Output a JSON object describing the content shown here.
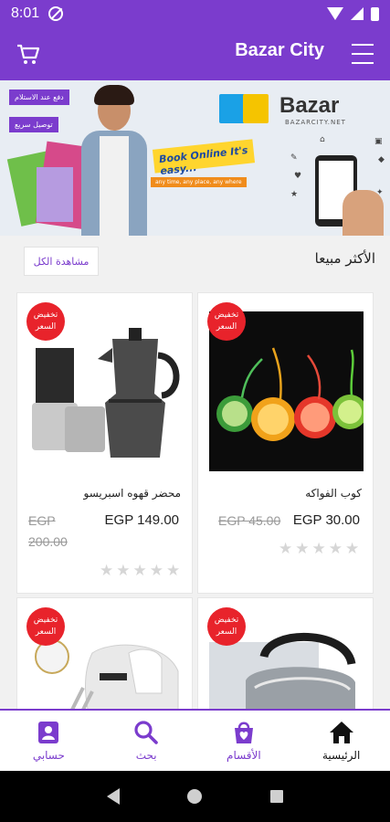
{
  "status_bar": {
    "time": "8:01"
  },
  "app_bar": {
    "title": "Bazar City",
    "cart_icon": "cart-icon",
    "menu_icon": "hamburger-menu-icon"
  },
  "banner": {
    "tag_top": "دفع عند الاستلام",
    "tag_second": "توصيل سريع",
    "book_online": "Book Online It's easy...",
    "slogan": "any time, any place, any where",
    "logo_text": "Bazar",
    "logo_sub": "BAZARCITY.NET"
  },
  "section": {
    "title": "الأكثر مبيعا",
    "see_all": "مشاهدة الكل"
  },
  "products": [
    {
      "badge": "تخفيض السعر",
      "name": "كوب الفواكه",
      "price": "EGP 30.00",
      "old_price": "EGP 45.00",
      "rating": 0
    },
    {
      "badge": "تخفيض السعر",
      "name": "محضر قهوه اسبريسو",
      "price": "EGP 149.00",
      "old_price_line1": "EGP",
      "old_price_line2": "200.00",
      "rating": 0
    },
    {
      "badge": "تخفيض السعر"
    },
    {
      "badge": "تخفيض السعر"
    }
  ],
  "bottom_nav": [
    {
      "label": "الرئيسية",
      "icon": "home-icon",
      "active": true
    },
    {
      "label": "الأقسام",
      "icon": "categories-bag-icon",
      "active": false
    },
    {
      "label": "بحث",
      "icon": "search-icon",
      "active": false
    },
    {
      "label": "حسابي",
      "icon": "account-icon",
      "active": false
    }
  ],
  "colors": {
    "primary": "#7b3ccd",
    "badge": "#e8232b",
    "star_empty": "#d6d6d6"
  }
}
